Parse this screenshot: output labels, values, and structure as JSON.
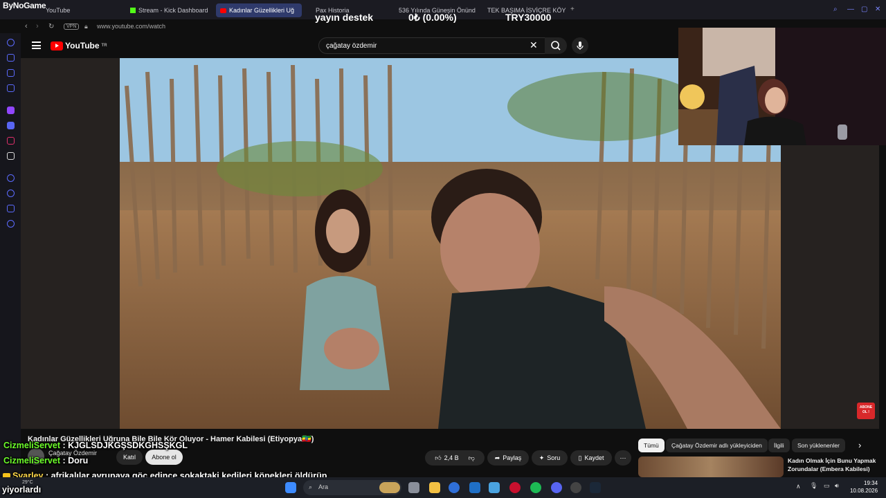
{
  "browser": {
    "brand": "ByNoGame",
    "tabs": [
      {
        "label": "YouTube"
      },
      {
        "label": "Stream - Kick Dashboard"
      },
      {
        "label": "Kadınlar Güzellikleri Uğ"
      },
      {
        "label": "Pax Historia"
      },
      {
        "label": "536 Yılında Güneşin Önünd"
      },
      {
        "label": "TEK BAŞIMA İSVİÇRE KÖYÜ"
      }
    ],
    "vpn_label": "VPN",
    "url": "www.youtube.com/watch"
  },
  "overlay": {
    "label": "yayın destek",
    "percent": "0₺ (0.00%)",
    "goal": "TRY30000"
  },
  "youtube": {
    "logo_text": "YouTube",
    "region": "TR",
    "search_query": "çağatay özdemir",
    "video": {
      "title": "Kadınlar Güzellikleri Uğruna Bile Bile Kör Oluyor - Hamer Kabilesi (Etiyopya🇪🇹)",
      "channel": "Çağatay Özdemir",
      "join_label": "Katıl",
      "subscribe_label": "Abone ol",
      "likes": "2,4 B",
      "share_label": "Paylaş",
      "ask_label": "Soru",
      "save_label": "Kaydet",
      "subscribe_overlay": "ABONE OL !"
    },
    "chips": [
      "Tümü",
      "Çağatay Özdemir adlı yükleyiciden",
      "İlgili",
      "Son yüklenenler"
    ],
    "recommended": {
      "title_line1": "Kadın Olmak İçin Bunu Yapmak",
      "title_line2": "Zorundalar (Embera Kabilesi)"
    }
  },
  "chat": [
    {
      "user": "CizmeliServet",
      "sep": " : ",
      "message": "KJGLSDJKGŞSDKGHSŞKGL"
    },
    {
      "user": "CizmeliServet",
      "sep": " : ",
      "message": "Doru"
    },
    {
      "user": "Svarley",
      "sep": " : ",
      "message": "afrikalılar avrupaya göç edince sokaktaki kedileri köpekleri öldürüp"
    },
    {
      "message": "yiyorlardı"
    }
  ],
  "taskbar": {
    "search_placeholder": "Ara",
    "time": "19:34",
    "date": "10.08.2026",
    "weather": "29°C"
  }
}
